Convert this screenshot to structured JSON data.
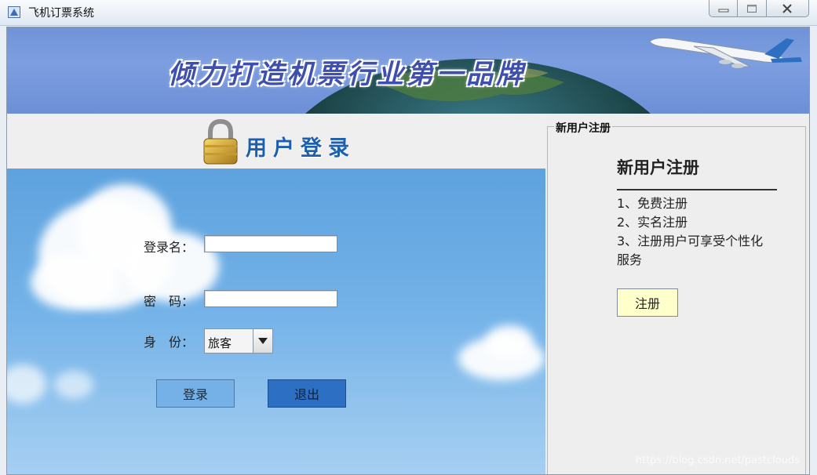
{
  "window": {
    "title": "飞机订票系统",
    "controls": [
      "minimize",
      "maximize",
      "close"
    ]
  },
  "banner": {
    "slogan": "倾力打造机票行业第一品牌"
  },
  "login": {
    "title": "用户登录",
    "username_label": "登录名：",
    "username_value": "",
    "password_label": "密　码：",
    "password_value": "",
    "role_label": "身　份：",
    "role_value": "旅客",
    "login_button": "登录",
    "exit_button": "退出"
  },
  "register": {
    "group_title": "新用户注册",
    "heading": "新用户注册",
    "items": [
      "1、免费注册",
      "2、实名注册",
      "3、注册用户可享受个性化",
      "服务"
    ],
    "button": "注册"
  },
  "watermark": "https://blog.csdn.net/pastclouds",
  "colors": {
    "banner_bg": "#7a9ce0",
    "sky_top": "#5ea2de",
    "login_button_bg": "#75b1e6",
    "exit_button_bg": "#2c6fc3",
    "register_button_bg": "#ffffcc"
  }
}
